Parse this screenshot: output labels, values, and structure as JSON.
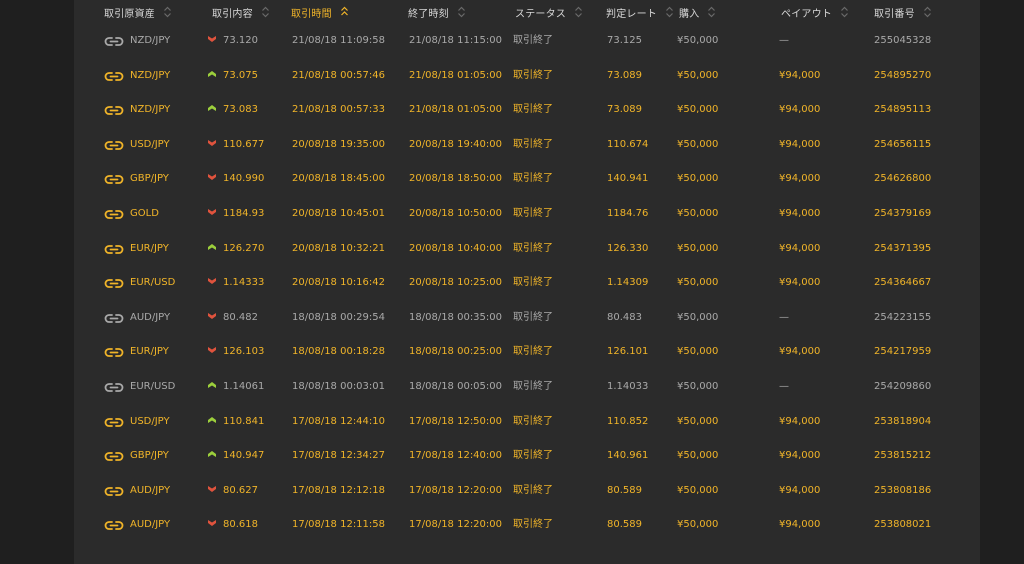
{
  "colors": {
    "win": "#f0b429",
    "lose": "#a9a9a9",
    "high": "#9ccf3c",
    "low": "#e0533d",
    "background": "#2b2b2b"
  },
  "table": {
    "columns": [
      {
        "key": "asset",
        "label": "取引原資産",
        "sortable": true,
        "active": false
      },
      {
        "key": "content",
        "label": "取引内容",
        "sortable": true,
        "active": false
      },
      {
        "key": "trade_time",
        "label": "取引時間",
        "sortable": true,
        "active": true,
        "sort_direction": "asc"
      },
      {
        "key": "end_time",
        "label": "終了時刻",
        "sortable": true,
        "active": false
      },
      {
        "key": "status",
        "label": "ステータス",
        "sortable": true,
        "active": false
      },
      {
        "key": "rate",
        "label": "判定レート",
        "sortable": true,
        "active": false
      },
      {
        "key": "purchase",
        "label": "購入",
        "sortable": true,
        "active": false
      },
      {
        "key": "payout",
        "label": "ペイアウト",
        "sortable": true,
        "active": false
      },
      {
        "key": "trade_id",
        "label": "取引番号",
        "sortable": true,
        "active": false
      }
    ],
    "rows": [
      {
        "result": "lost",
        "asset": "NZD/JPY",
        "direction": "low",
        "content": "73.120",
        "trade_time": "21/08/18 11:09:58",
        "end_time": "21/08/18 11:15:00",
        "status": "取引終了",
        "rate": "73.125",
        "purchase": "¥50,000",
        "payout": "—",
        "trade_id": "255045328"
      },
      {
        "result": "won",
        "asset": "NZD/JPY",
        "direction": "high",
        "content": "73.075",
        "trade_time": "21/08/18 00:57:46",
        "end_time": "21/08/18 01:05:00",
        "status": "取引終了",
        "rate": "73.089",
        "purchase": "¥50,000",
        "payout": "¥94,000",
        "trade_id": "254895270"
      },
      {
        "result": "won",
        "asset": "NZD/JPY",
        "direction": "high",
        "content": "73.083",
        "trade_time": "21/08/18 00:57:33",
        "end_time": "21/08/18 01:05:00",
        "status": "取引終了",
        "rate": "73.089",
        "purchase": "¥50,000",
        "payout": "¥94,000",
        "trade_id": "254895113"
      },
      {
        "result": "won",
        "asset": "USD/JPY",
        "direction": "low",
        "content": "110.677",
        "trade_time": "20/08/18 19:35:00",
        "end_time": "20/08/18 19:40:00",
        "status": "取引終了",
        "rate": "110.674",
        "purchase": "¥50,000",
        "payout": "¥94,000",
        "trade_id": "254656115"
      },
      {
        "result": "won",
        "asset": "GBP/JPY",
        "direction": "low",
        "content": "140.990",
        "trade_time": "20/08/18 18:45:00",
        "end_time": "20/08/18 18:50:00",
        "status": "取引終了",
        "rate": "140.941",
        "purchase": "¥50,000",
        "payout": "¥94,000",
        "trade_id": "254626800"
      },
      {
        "result": "won",
        "asset": "GOLD",
        "direction": "low",
        "content": "1184.93",
        "trade_time": "20/08/18 10:45:01",
        "end_time": "20/08/18 10:50:00",
        "status": "取引終了",
        "rate": "1184.76",
        "purchase": "¥50,000",
        "payout": "¥94,000",
        "trade_id": "254379169"
      },
      {
        "result": "won",
        "asset": "EUR/JPY",
        "direction": "high",
        "content": "126.270",
        "trade_time": "20/08/18 10:32:21",
        "end_time": "20/08/18 10:40:00",
        "status": "取引終了",
        "rate": "126.330",
        "purchase": "¥50,000",
        "payout": "¥94,000",
        "trade_id": "254371395"
      },
      {
        "result": "won",
        "asset": "EUR/USD",
        "direction": "low",
        "content": "1.14333",
        "trade_time": "20/08/18 10:16:42",
        "end_time": "20/08/18 10:25:00",
        "status": "取引終了",
        "rate": "1.14309",
        "purchase": "¥50,000",
        "payout": "¥94,000",
        "trade_id": "254364667"
      },
      {
        "result": "lost",
        "asset": "AUD/JPY",
        "direction": "low",
        "content": "80.482",
        "trade_time": "18/08/18 00:29:54",
        "end_time": "18/08/18 00:35:00",
        "status": "取引終了",
        "rate": "80.483",
        "purchase": "¥50,000",
        "payout": "—",
        "trade_id": "254223155"
      },
      {
        "result": "won",
        "asset": "EUR/JPY",
        "direction": "low",
        "content": "126.103",
        "trade_time": "18/08/18 00:18:28",
        "end_time": "18/08/18 00:25:00",
        "status": "取引終了",
        "rate": "126.101",
        "purchase": "¥50,000",
        "payout": "¥94,000",
        "trade_id": "254217959"
      },
      {
        "result": "lost",
        "asset": "EUR/USD",
        "direction": "high",
        "content": "1.14061",
        "trade_time": "18/08/18 00:03:01",
        "end_time": "18/08/18 00:05:00",
        "status": "取引終了",
        "rate": "1.14033",
        "purchase": "¥50,000",
        "payout": "—",
        "trade_id": "254209860"
      },
      {
        "result": "won",
        "asset": "USD/JPY",
        "direction": "high",
        "content": "110.841",
        "trade_time": "17/08/18 12:44:10",
        "end_time": "17/08/18 12:50:00",
        "status": "取引終了",
        "rate": "110.852",
        "purchase": "¥50,000",
        "payout": "¥94,000",
        "trade_id": "253818904"
      },
      {
        "result": "won",
        "asset": "GBP/JPY",
        "direction": "high",
        "content": "140.947",
        "trade_time": "17/08/18 12:34:27",
        "end_time": "17/08/18 12:40:00",
        "status": "取引終了",
        "rate": "140.961",
        "purchase": "¥50,000",
        "payout": "¥94,000",
        "trade_id": "253815212"
      },
      {
        "result": "won",
        "asset": "AUD/JPY",
        "direction": "low",
        "content": "80.627",
        "trade_time": "17/08/18 12:12:18",
        "end_time": "17/08/18 12:20:00",
        "status": "取引終了",
        "rate": "80.589",
        "purchase": "¥50,000",
        "payout": "¥94,000",
        "trade_id": "253808186"
      },
      {
        "result": "won",
        "asset": "AUD/JPY",
        "direction": "low",
        "content": "80.618",
        "trade_time": "17/08/18 12:11:58",
        "end_time": "17/08/18 12:20:00",
        "status": "取引終了",
        "rate": "80.589",
        "purchase": "¥50,000",
        "payout": "¥94,000",
        "trade_id": "253808021"
      }
    ]
  }
}
